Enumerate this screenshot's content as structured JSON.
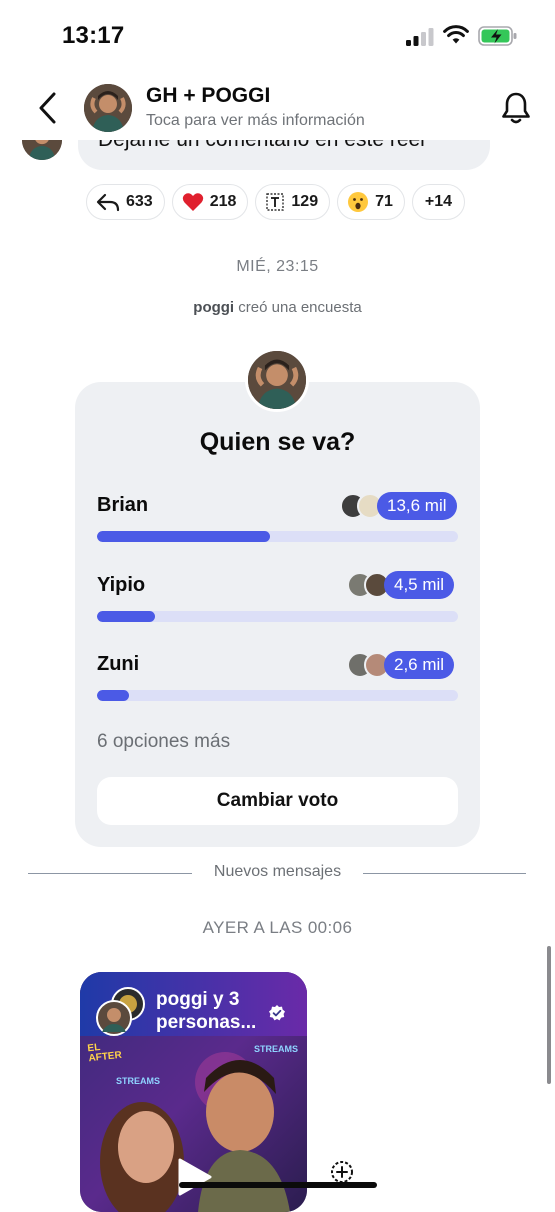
{
  "status_bar": {
    "time": "13:17"
  },
  "header": {
    "title": "GH + POGGI",
    "subtitle": "Toca para ver más información"
  },
  "previous_message": {
    "text": "Dejame un comentario en este reel"
  },
  "reactions": [
    {
      "icon": "reply-icon",
      "count": "633"
    },
    {
      "icon": "heart-icon",
      "emoji": "❤️",
      "count": "218"
    },
    {
      "icon": "text-box-icon",
      "count": "129"
    },
    {
      "icon": "surprised-face-icon",
      "emoji": "😮",
      "count": "71"
    },
    {
      "icon": "",
      "count": "+14"
    }
  ],
  "day_label": "MIÉ, 23:15",
  "system_message": {
    "user": "poggi",
    "action": "creó una encuesta"
  },
  "poll": {
    "question": "Quien se va?",
    "options": [
      {
        "label": "Brian",
        "count": "13,6 mil",
        "fill": 0.48
      },
      {
        "label": "Yipio",
        "count": "4,5 mil",
        "fill": 0.16
      },
      {
        "label": "Zuni",
        "count": "2,6 mil",
        "fill": 0.09
      }
    ],
    "more_options": "6 opciones más",
    "change_vote": "Cambiar voto",
    "accent": "#4b5ae6"
  },
  "new_messages_label": "Nuevos mensajes",
  "yesterday_label": "AYER A LAS 00:06",
  "reel": {
    "title": "poggi y 3 personas...",
    "overlay_top_left": "EL AFTER",
    "overlay_streams_1": "STREAMS",
    "overlay_streams_2": "STREAMS"
  }
}
